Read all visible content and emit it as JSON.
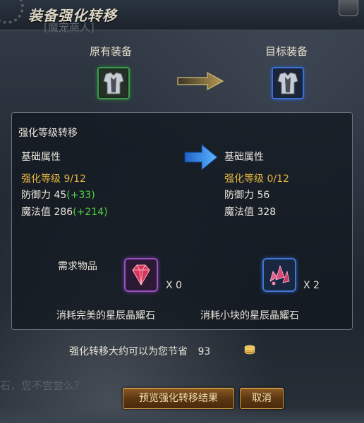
{
  "window": {
    "title": "装备强化转移",
    "subtitle": "[魔宠商人]"
  },
  "equipment": {
    "original_label": "原有装备",
    "target_label": "目标装备"
  },
  "transfer": {
    "section_title": "强化等级转移",
    "left": {
      "heading": "基础属性",
      "level_label": "强化等级",
      "level_value": "9/12",
      "defense_label": "防御力",
      "defense_value": "45",
      "defense_bonus": "(+33)",
      "magic_label": "魔法值",
      "magic_value": "286",
      "magic_bonus": "(+214)"
    },
    "right": {
      "heading": "基础属性",
      "level_label": "强化等级",
      "level_value": "0/12",
      "defense_label": "防御力",
      "defense_value": "56",
      "magic_label": "魔法值",
      "magic_value": "328"
    }
  },
  "requirements": {
    "label": "需求物品",
    "items": [
      {
        "qty": "X 0",
        "caption": "消耗完美的星辰晶耀石",
        "icon": "perfect-star-crystal-icon"
      },
      {
        "qty": "X 2",
        "caption": "消耗小块的星辰晶耀石",
        "icon": "small-star-crystal-icon"
      }
    ]
  },
  "savings": {
    "text": "强化转移大约可以为您节省",
    "amount": "93",
    "icon": "gold-coin-icon"
  },
  "background": {
    "faded_text": "石，您不尝尝么？"
  },
  "buttons": {
    "preview": "预览强化转移结果",
    "cancel": "取消"
  },
  "colors": {
    "gold": "#e3b33f",
    "green": "#55d045",
    "button_border": "#c99a3e"
  }
}
